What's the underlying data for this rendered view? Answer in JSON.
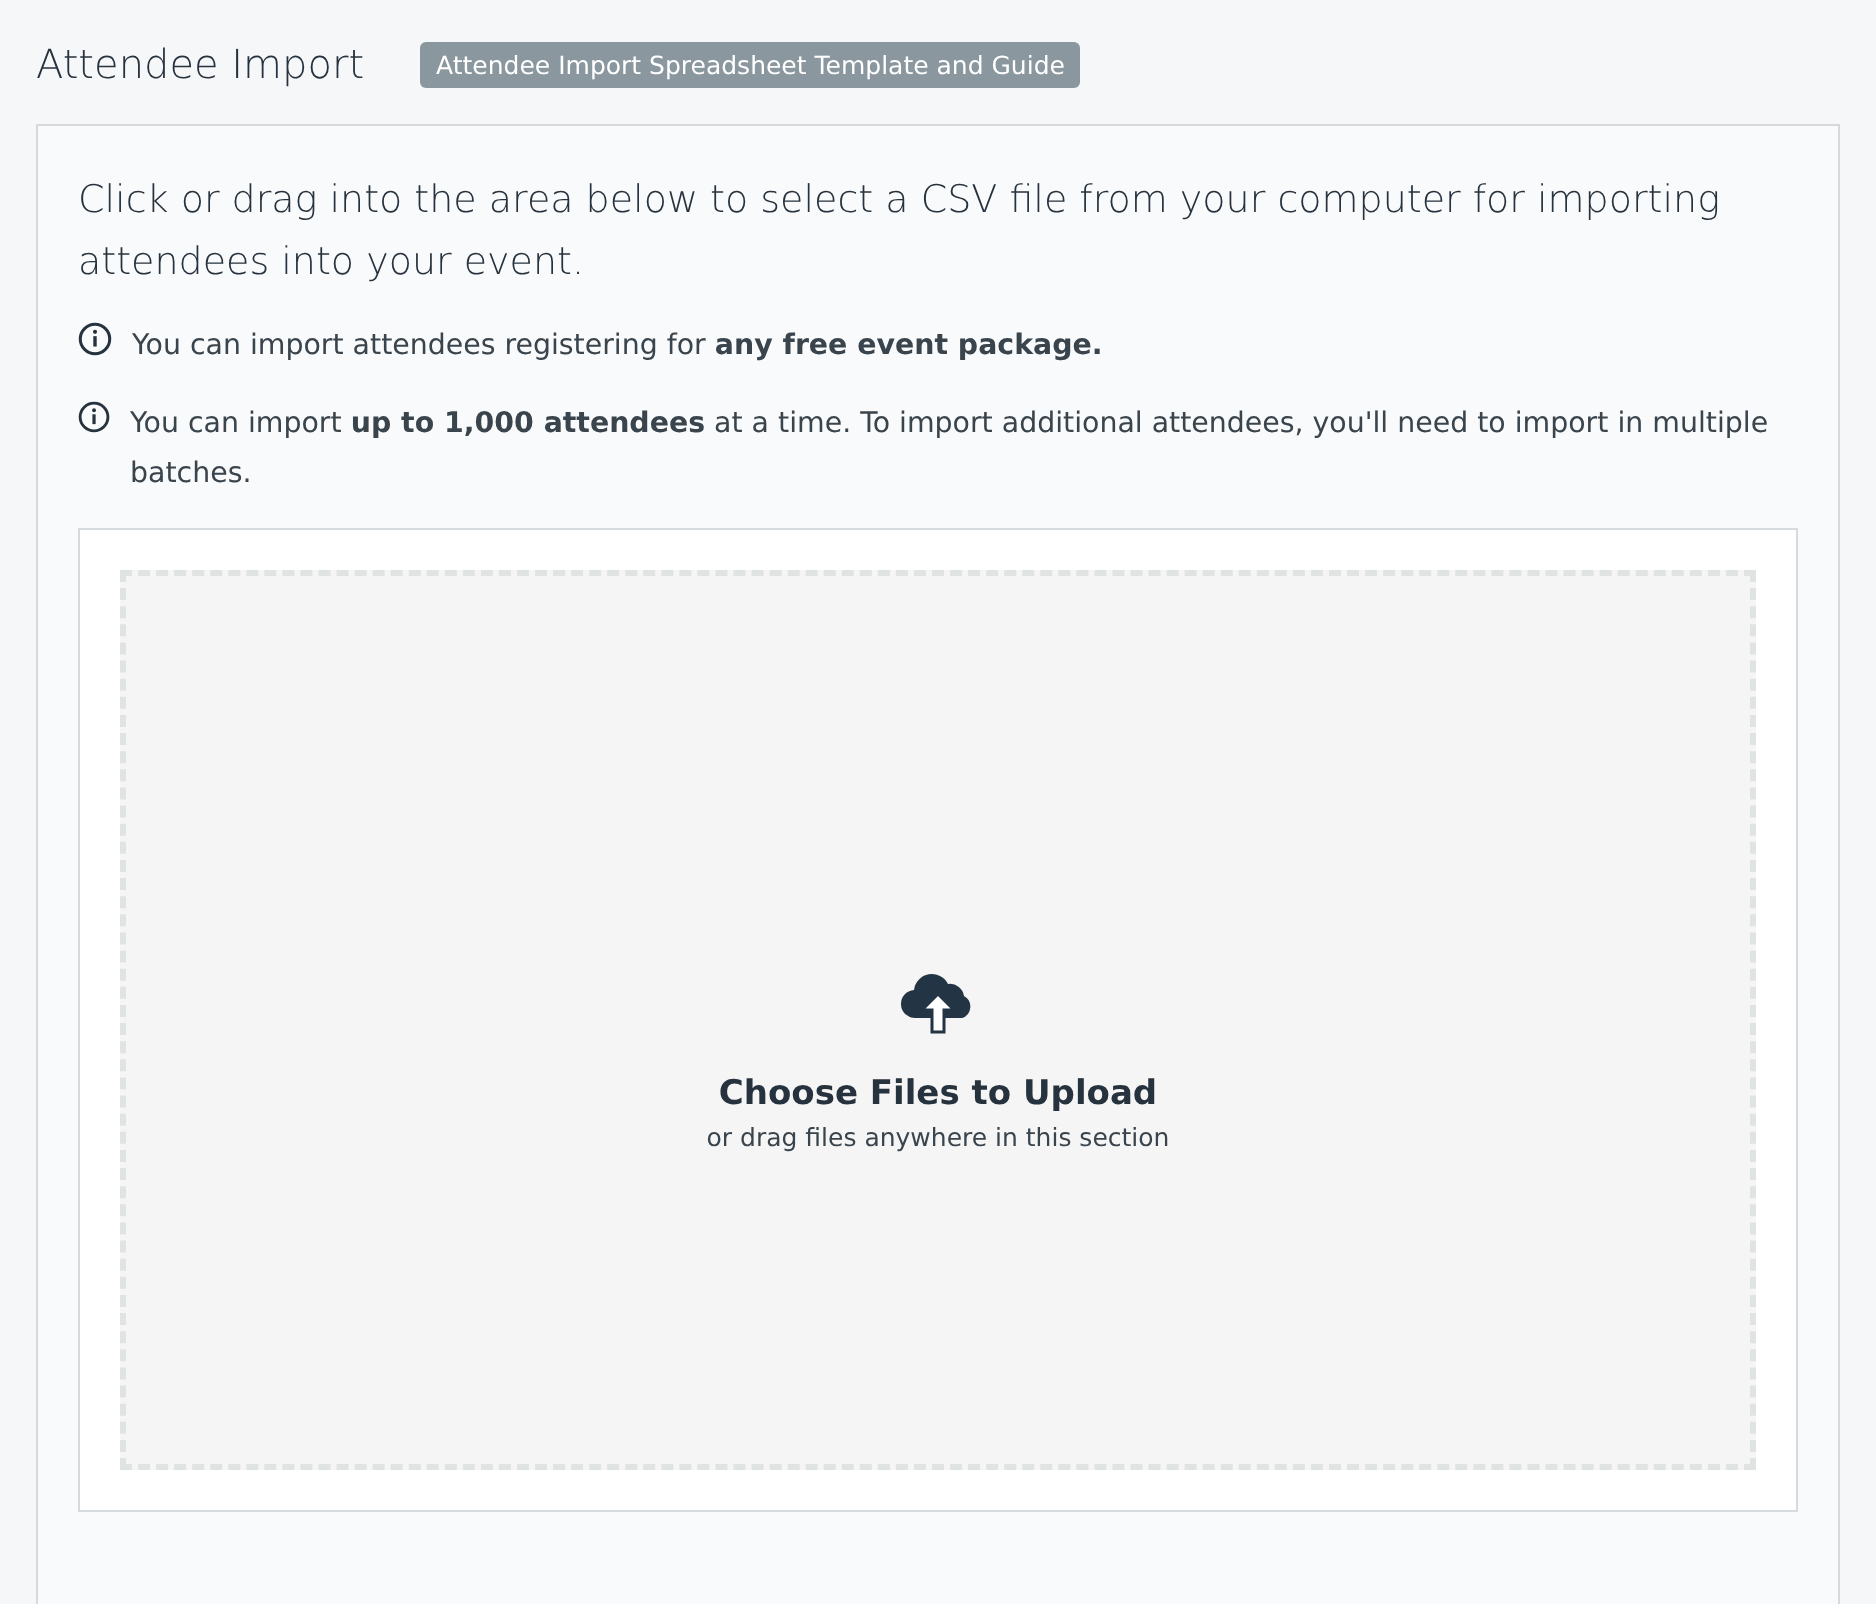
{
  "header": {
    "title": "Attendee Import",
    "guide_link": "Attendee Import Spreadsheet Template and Guide"
  },
  "intro": "Click or drag into the area below to select a CSV file from your computer for importing attendees into your event.",
  "notes": [
    "You can import attendees registering for **any free event package.**",
    "You can import **up to 1,000 attendees** at a time. To import additional attendees, you'll need to import in multiple batches."
  ],
  "dropzone": {
    "title": "Choose Files to Upload",
    "hint": "or drag files anywhere in this section"
  }
}
